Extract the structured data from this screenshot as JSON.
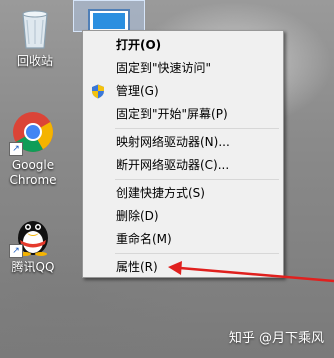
{
  "desktop": {
    "recycle_bin_label": "回收站",
    "chrome_label": "Google Chrome",
    "qq_label": "腾讯QQ"
  },
  "context_menu": {
    "items": [
      {
        "label": "打开(O)",
        "bold": true
      },
      {
        "label": "固定到\"快速访问\""
      },
      {
        "label": "管理(G)",
        "icon": "uac-shield-icon"
      },
      {
        "label": "固定到\"开始\"屏幕(P)"
      },
      {
        "label": "映射网络驱动器(N)..."
      },
      {
        "label": "断开网络驱动器(C)..."
      },
      {
        "label": "创建快捷方式(S)"
      },
      {
        "label": "删除(D)"
      },
      {
        "label": "重命名(M)"
      },
      {
        "label": "属性(R)"
      }
    ]
  },
  "annotation": {
    "color": "#e0201e"
  },
  "watermark": {
    "text": "知乎 @月下乘风"
  }
}
